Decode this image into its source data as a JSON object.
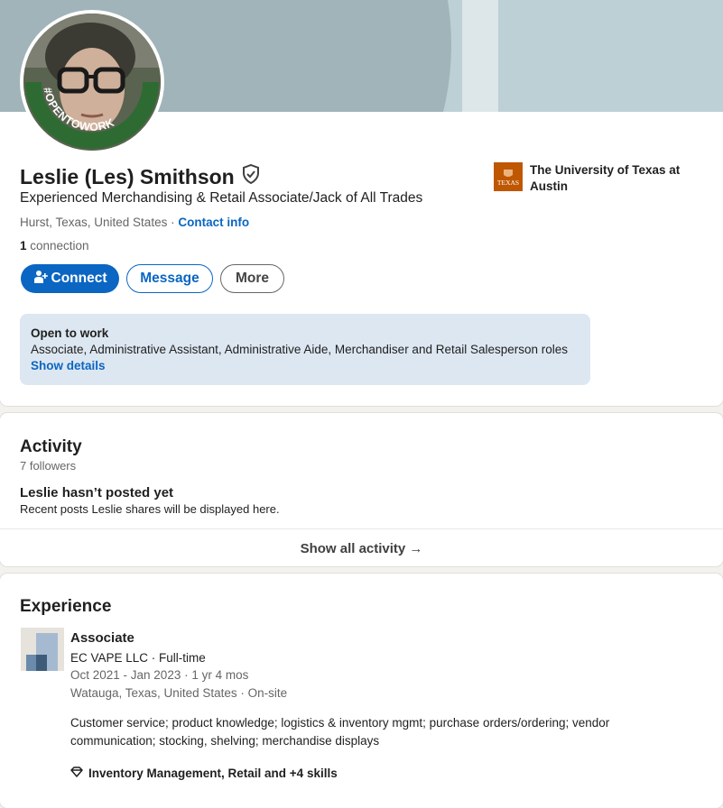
{
  "profile": {
    "name": "Leslie (Les) Smithson",
    "headline": "Experienced Merchandising & Retail Associate/Jack of All Trades",
    "location": "Hurst, Texas, United States",
    "location_sep": " · ",
    "contact_info": "Contact info",
    "connections_count": "1",
    "connections_label": " connection",
    "open_to_work_badge": "#OPENTOWORK",
    "verified_icon": "shield-check-icon"
  },
  "actions": {
    "connect": "Connect",
    "message": "Message",
    "more": "More"
  },
  "education": {
    "school": "The University of Texas at Austin",
    "logo_text": "TEXAS"
  },
  "open_to_work": {
    "title": "Open to work",
    "roles": "Associate, Administrative Assistant, Administrative Aide, Merchandiser and Retail Salesperson roles",
    "link": "Show details"
  },
  "activity": {
    "title": "Activity",
    "followers": "7 followers",
    "empty_title": "Leslie hasn’t posted yet",
    "empty_desc": "Recent posts Leslie shares will be displayed here.",
    "show_all": "Show all activity →"
  },
  "experience": {
    "title": "Experience",
    "items": [
      {
        "role": "Associate",
        "company": "EC VAPE LLC · Full-time",
        "dates": "Oct 2021 - Jan 2023 · 1 yr 4 mos",
        "location": "Watauga, Texas, United States · On-site",
        "description": "Customer service; product knowledge; logistics & inventory mgmt; purchase orders/ordering; vendor communication; stocking, shelving; merchandise displays",
        "skills": "Inventory Management, Retail and +4 skills"
      }
    ]
  },
  "colors": {
    "brand_blue": "#0a66c2",
    "open_to_work_green": "#2e6b32",
    "texas_orange": "#bf5700"
  }
}
